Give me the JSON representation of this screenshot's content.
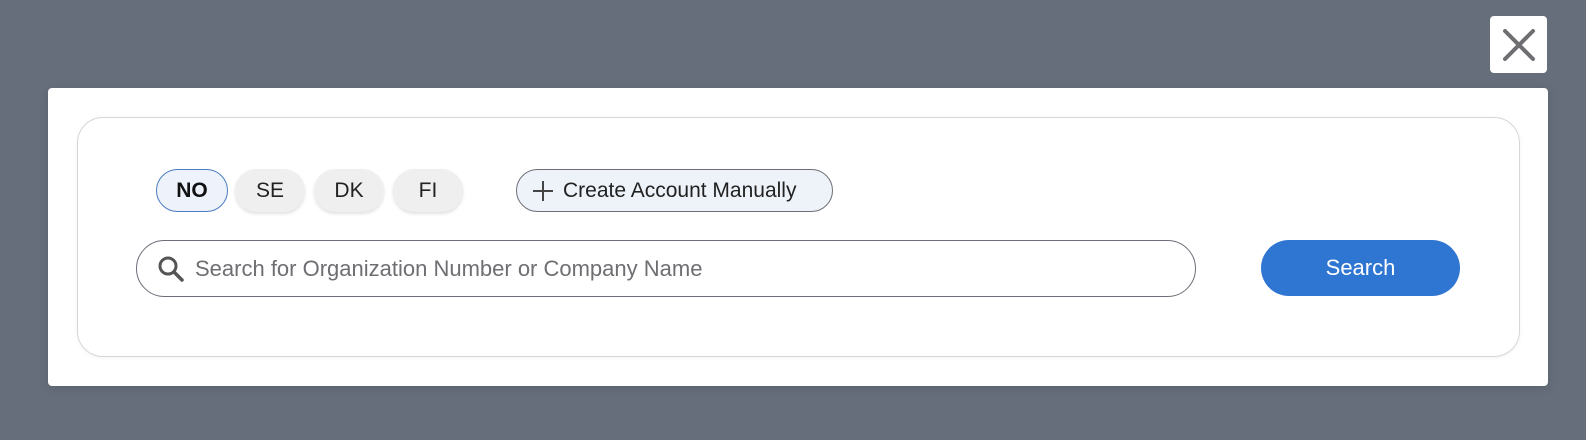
{
  "close": {
    "icon": "close-icon"
  },
  "countries": [
    {
      "label": "NO",
      "active": true
    },
    {
      "label": "SE",
      "active": false
    },
    {
      "label": "DK",
      "active": false
    },
    {
      "label": "FI",
      "active": false
    }
  ],
  "create_account": {
    "label": "Create Account Manually",
    "icon": "plus-icon"
  },
  "search": {
    "placeholder": "Search for Organization Number or Company Name",
    "value": "",
    "icon": "search-icon",
    "button_label": "Search"
  },
  "colors": {
    "backdrop": "#666e7c",
    "accent": "#2f76d2",
    "active_pill_border": "#4a7bc4"
  }
}
